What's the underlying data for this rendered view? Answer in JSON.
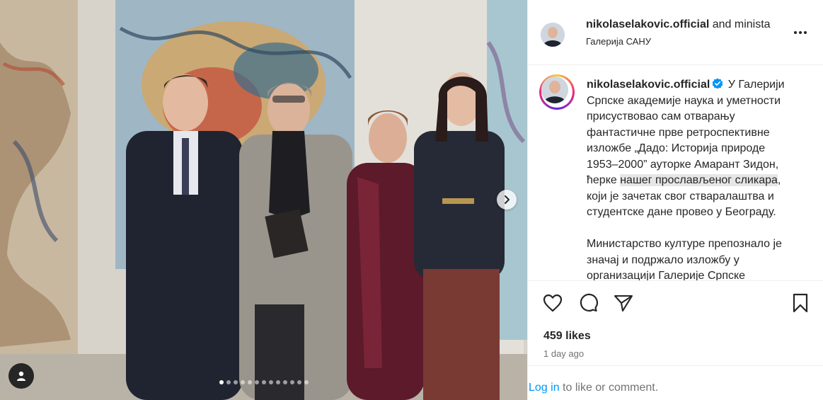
{
  "post": {
    "username": "nikolaselakovic.official",
    "collab_suffix": "and minista",
    "location": "Галерија САНУ",
    "caption_parts": {
      "p1_before": "У Галерији Српске академије наука и уметности присуствовао сам отварању фантастичне прве ретроспективне изложбе „Дадо: Историја природе 1953–2000” ауторке Амарант Зидон, ћерке ",
      "p1_highlight": "нашег прослављеног сликара",
      "p1_after": ", који је зачетак свог стваралаштва и студентске дане провео у Београду.",
      "p2": "Министарство културе препознало је значај и подржало изложбу у организацији Галерије Српске"
    },
    "likes": "459 likes",
    "date": "1 day ago",
    "login_link": "Log in",
    "login_suffix": " to like or comment."
  },
  "carousel": {
    "total": 13,
    "active": 1
  },
  "icons": {
    "more": "more-options-icon",
    "verified": "verified-badge-icon",
    "like": "heart-icon",
    "comment": "comment-icon",
    "share": "send-icon",
    "save": "bookmark-icon",
    "next": "chevron-right-icon",
    "tags": "user-tag-icon"
  },
  "colors": {
    "link": "#0095f6",
    "verified": "#0095f6",
    "text": "#262626",
    "muted": "#737373"
  }
}
